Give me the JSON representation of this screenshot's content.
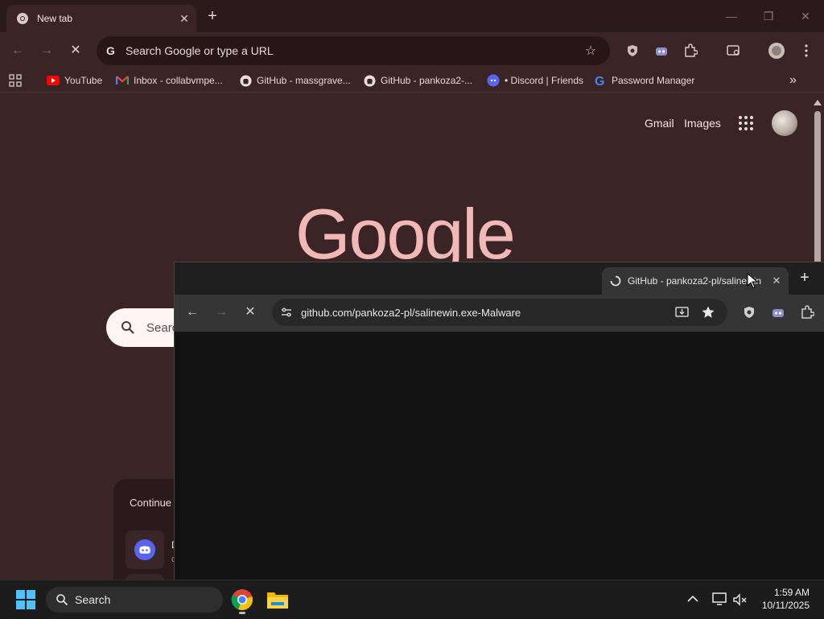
{
  "back_window": {
    "tab": {
      "title": "New tab",
      "favicon": "chrome-icon",
      "close": "✕"
    },
    "new_tab_symbol": "+",
    "window_controls": {
      "minimize": "—",
      "maximize": "❐",
      "close": "✕"
    },
    "nav": {
      "back": "←",
      "forward": "→",
      "stop": "✕"
    },
    "omnibox": {
      "placeholder": "Search Google or type a URL"
    },
    "bookmarks": [
      {
        "label": "YouTube",
        "icon": "youtube-icon"
      },
      {
        "label": "Inbox - collabvmpe...",
        "icon": "gmail-icon"
      },
      {
        "label": "GitHub - massgrave...",
        "icon": "github-icon"
      },
      {
        "label": "GitHub - pankoza2-...",
        "icon": "github-icon"
      },
      {
        "label": "• Discord | Friends",
        "icon": "discord-icon"
      },
      {
        "label": "Password Manager",
        "icon": "google-g-icon"
      }
    ],
    "bookmarks_overflow": "»",
    "ntp": {
      "gmail": "Gmail",
      "images": "Images",
      "logo_text": "Google",
      "search_placeholder": "Search",
      "continue_label": "Continue",
      "tile_letter": "D",
      "tile_sub": "c"
    }
  },
  "front_window": {
    "tab": {
      "title": "GitHub - pankoza2-pl/salinewin",
      "favicon": "github-icon",
      "close": "✕"
    },
    "new_tab_symbol": "+",
    "nav": {
      "back": "←",
      "forward": "→",
      "stop": "✕"
    },
    "omnibox": {
      "url": "github.com/pankoza2-pl/salinewin.exe-Malware"
    }
  },
  "taskbar": {
    "search_placeholder": "Search",
    "clock_time": "1:59 AM",
    "clock_date": "10/11/2025"
  },
  "colors": {
    "theme_dark": "#2a1a1c",
    "theme_main": "#3b2426",
    "google_logo": "#f2b8b5",
    "front_window_bg": "#131313",
    "taskbar": "#1c1c1c"
  }
}
